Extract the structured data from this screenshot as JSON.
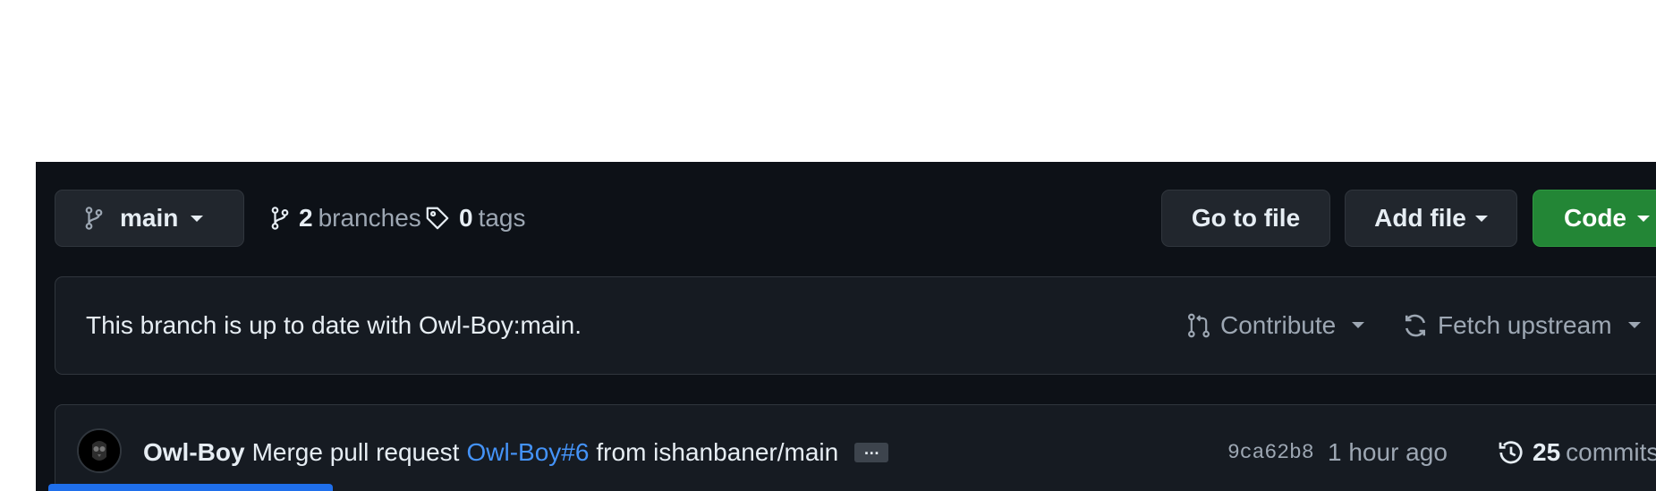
{
  "toolbar": {
    "branch_name": "main",
    "branches_count": "2",
    "branches_label": "branches",
    "tags_count": "0",
    "tags_label": "tags",
    "go_to_file_label": "Go to file",
    "add_file_label": "Add file",
    "code_label": "Code"
  },
  "status": {
    "message": "This branch is up to date with Owl-Boy:main.",
    "contribute_label": "Contribute",
    "fetch_upstream_label": "Fetch upstream"
  },
  "latest_commit": {
    "author": "Owl-Boy",
    "message_prefix": "Merge pull request",
    "pr_ref": "Owl-Boy#6",
    "message_suffix": "from ishanbaner/main",
    "ellipsis": "…",
    "sha": "9ca62b8",
    "time": "1 hour ago",
    "commits_count": "25",
    "commits_label": "commits"
  },
  "colors": {
    "background": "#0d1117",
    "code_button": "#238636",
    "link": "#4493f8"
  },
  "icons": {
    "branch": "git-branch-icon",
    "tag": "tag-icon",
    "contribute": "git-pull-request-icon",
    "fetch": "sync-icon",
    "history": "history-icon"
  }
}
